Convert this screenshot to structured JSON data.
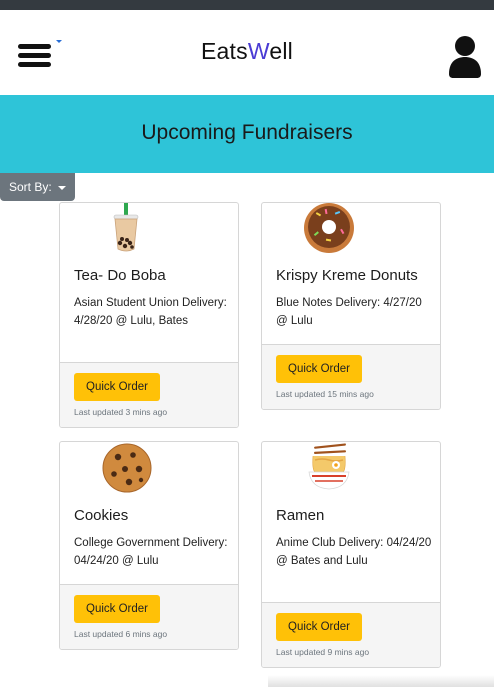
{
  "navbar": {
    "brand_prefix": "Eats",
    "brand_accent": "W",
    "brand_suffix": "ell"
  },
  "hero": {
    "title": "Upcoming Fundraisers"
  },
  "sort": {
    "label": "Sort By:"
  },
  "cards": [
    {
      "icon": "boba-tea-icon",
      "title": "Tea- Do Boba",
      "desc": "Asian Student Union Delivery: 4/28/20 @ Lulu, Bates",
      "button": "Quick Order",
      "updated": "Last updated 3 mins ago"
    },
    {
      "icon": "donut-icon",
      "title": "Krispy Kreme Donuts",
      "desc": "Blue Notes Delivery: 4/27/20 @ Lulu",
      "button": "Quick Order",
      "updated": "Last updated 15 mins ago"
    },
    {
      "icon": "cookie-icon",
      "title": "Cookies",
      "desc": "College Government Delivery: 04/24/20 @ Lulu",
      "button": "Quick Order",
      "updated": "Last updated 6 mins ago"
    },
    {
      "icon": "ramen-icon",
      "title": "Ramen",
      "desc": "Anime Club Delivery: 04/24/20 @ Bates and Lulu",
      "button": "Quick Order",
      "updated": "Last updated 9 mins ago"
    }
  ],
  "colors": {
    "hero_bg": "#2ec4d8",
    "brand_accent": "#4a3bd4",
    "button": "#ffc107",
    "sort_button": "#6c757d"
  }
}
